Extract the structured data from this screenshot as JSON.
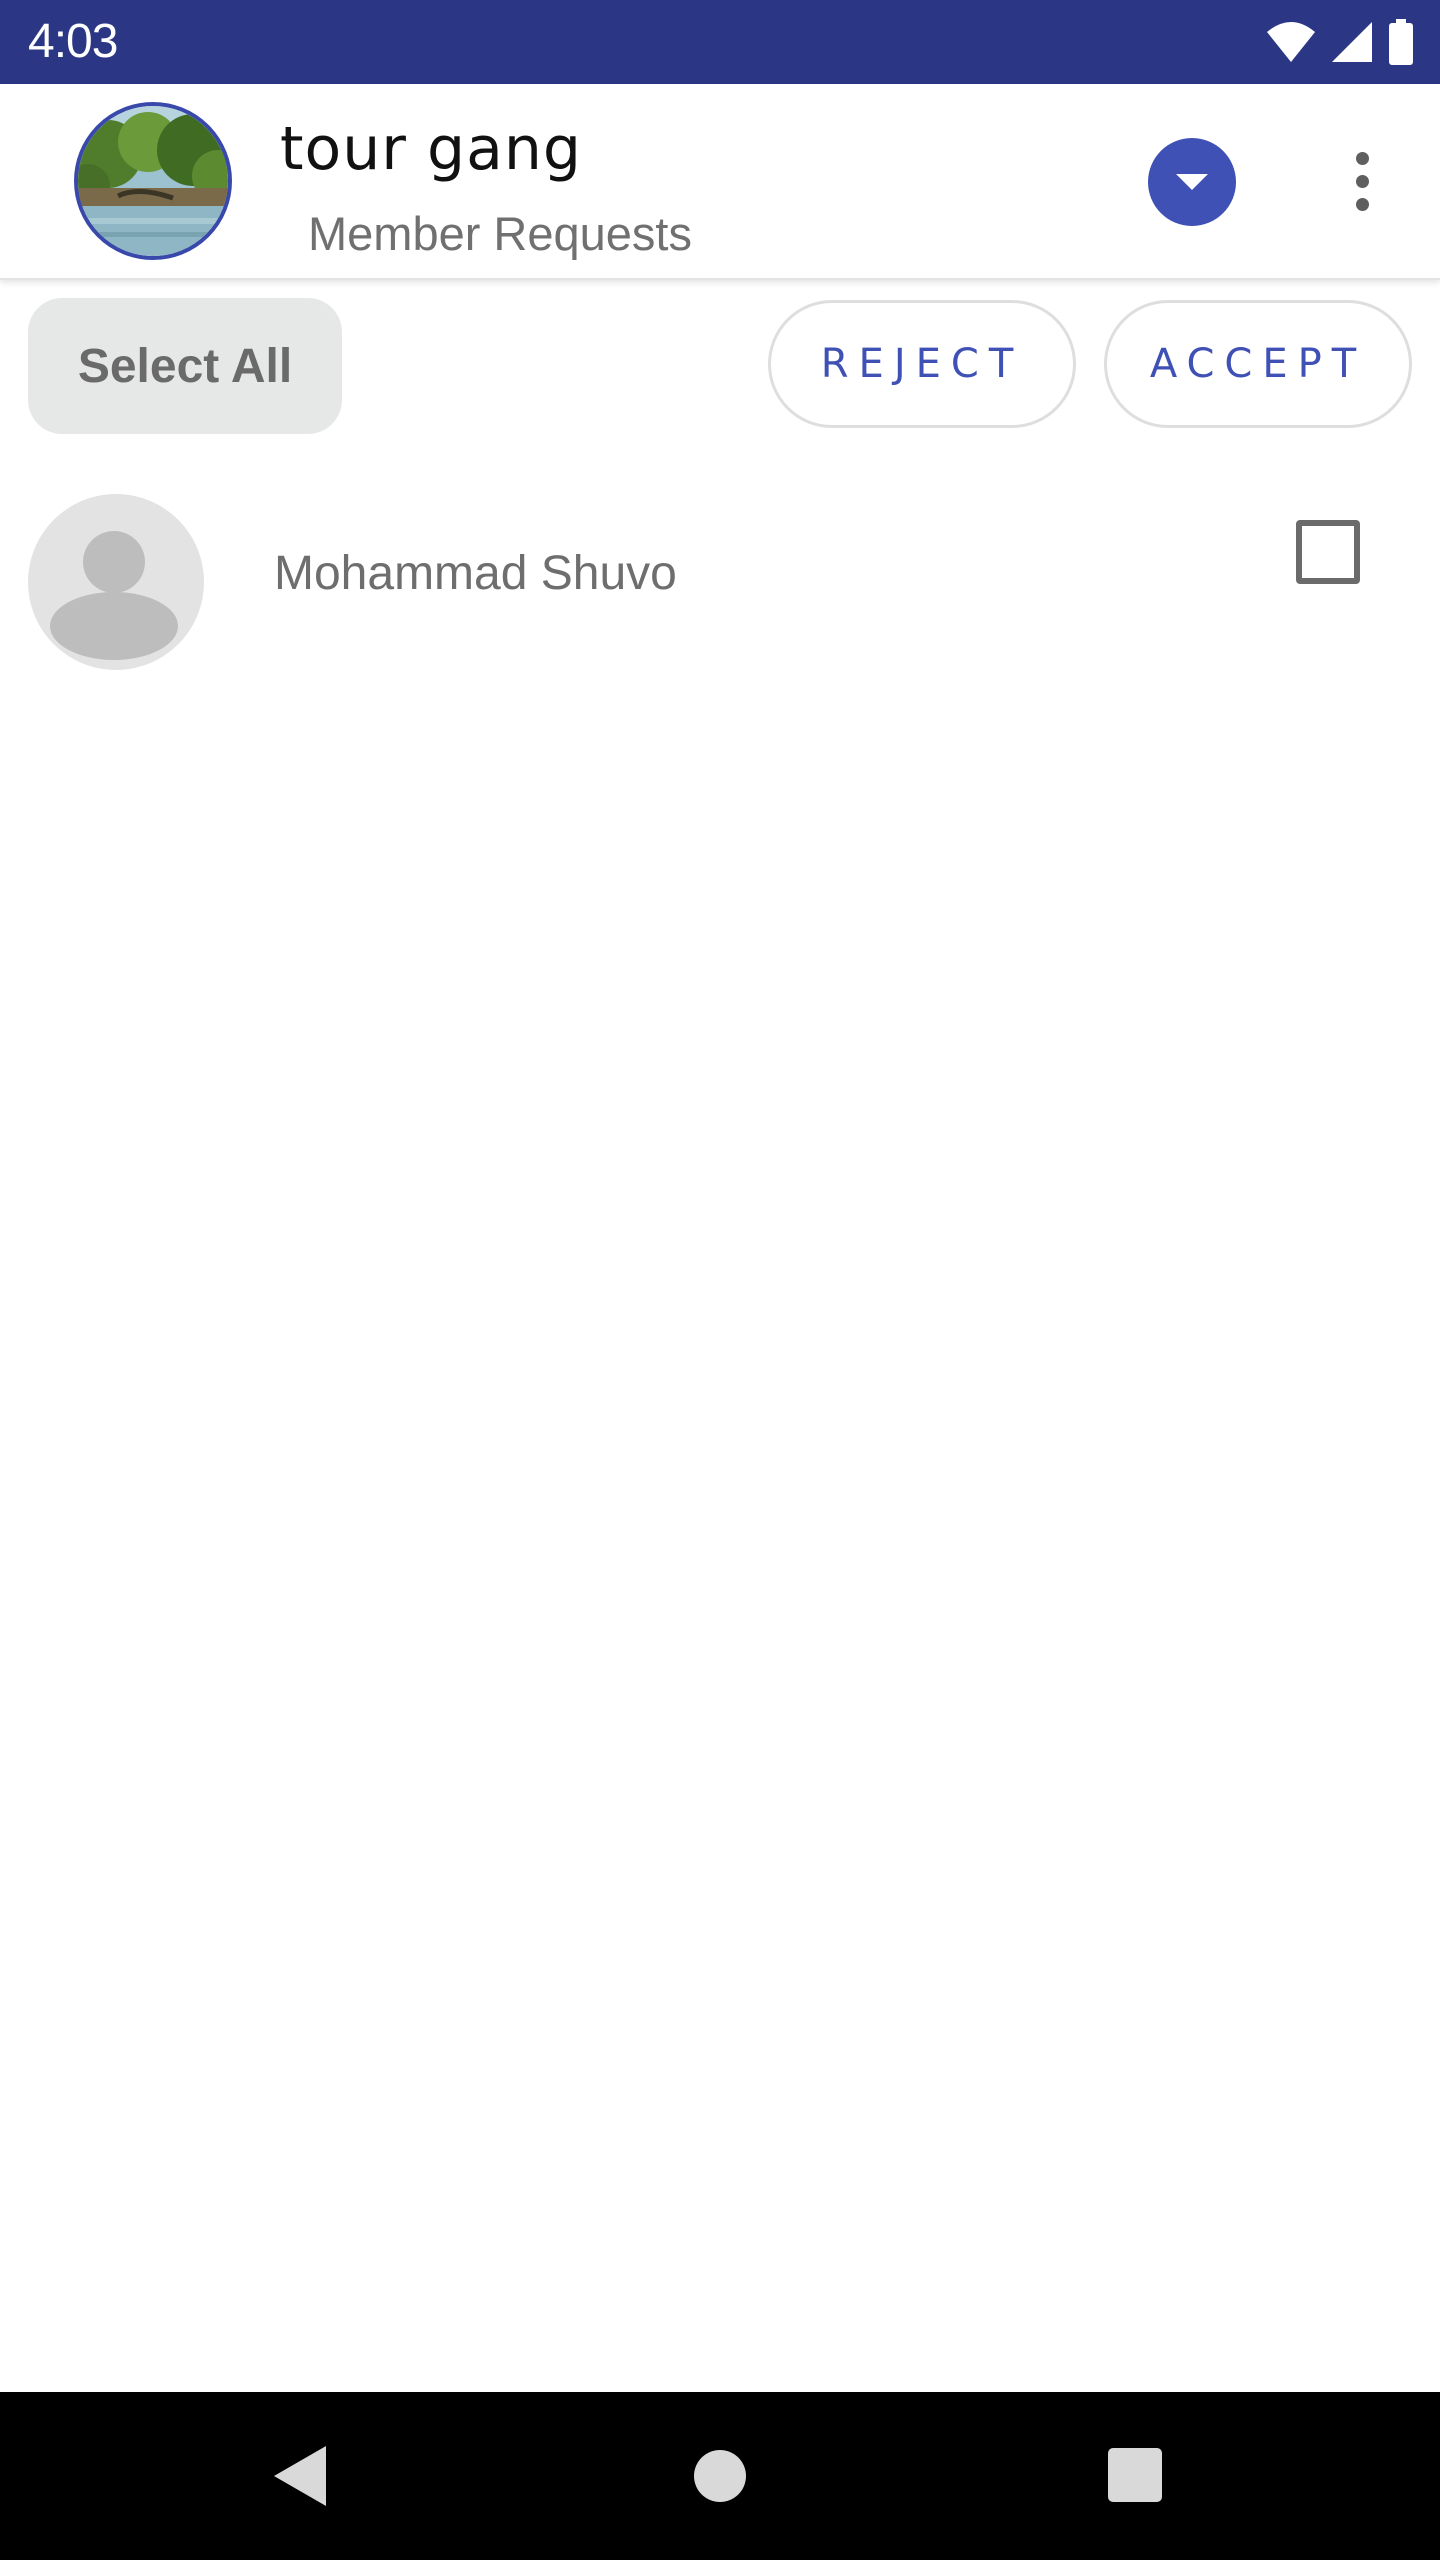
{
  "status_bar": {
    "time": "4:03",
    "icons": [
      "wifi-icon",
      "cell-signal-icon",
      "battery-icon"
    ],
    "background": "#2b3784"
  },
  "toolbar": {
    "title": "tour gang",
    "subtitle": "Member Requests",
    "avatar": "group-avatar-landscape",
    "dropdown_icon": "chevron-down-icon",
    "menu_icon": "more-vert-icon"
  },
  "actions": {
    "select_all_label": "Select All",
    "reject_label": "REJECT",
    "accept_label": "ACCEPT"
  },
  "requests": [
    {
      "name": "Mohammad Shuvo",
      "avatar": "person-placeholder-icon",
      "checked": false
    }
  ],
  "nav_bar": {
    "buttons": [
      "back-icon",
      "home-icon",
      "recents-icon"
    ]
  },
  "colors": {
    "accent": "#3f51b5",
    "status_bar": "#2b3784",
    "select_all_bg": "#e6e7e7"
  }
}
